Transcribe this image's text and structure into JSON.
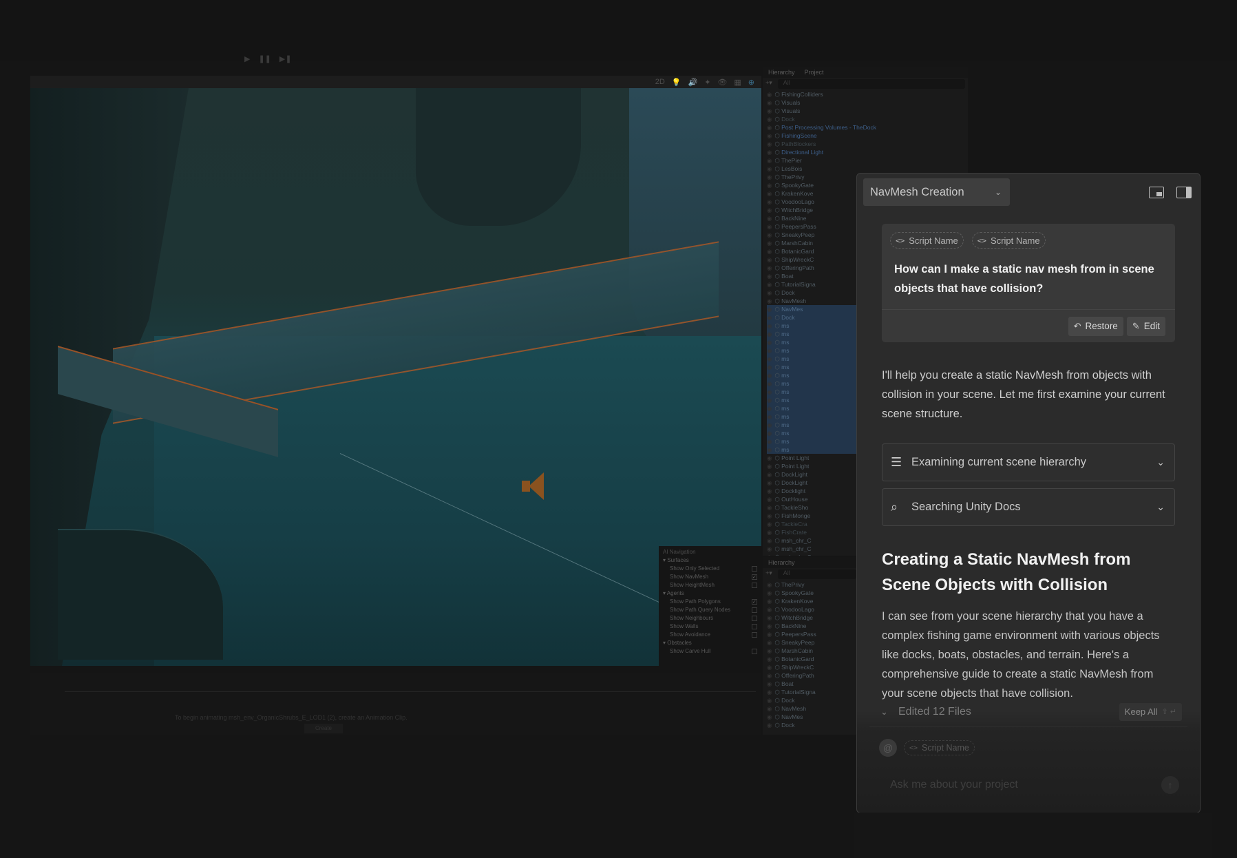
{
  "editor": {
    "toolbar_icons": [
      "2D",
      "💡",
      "🔊",
      "✦",
      "👁",
      "▦",
      "⊕"
    ],
    "ai_navigation": {
      "title": "AI Navigation",
      "sections": [
        {
          "label": "Surfaces",
          "items": [
            {
              "label": "Show Only Selected",
              "checked": false
            },
            {
              "label": "Show NavMesh",
              "checked": true
            },
            {
              "label": "Show HeightMesh",
              "checked": false
            }
          ]
        },
        {
          "label": "Agents",
          "items": [
            {
              "label": "Show Path Polygons",
              "checked": true
            },
            {
              "label": "Show Path Query Nodes",
              "checked": false
            },
            {
              "label": "Show Neighbours",
              "checked": false
            },
            {
              "label": "Show Walls",
              "checked": false
            },
            {
              "label": "Show Avoidance",
              "checked": false
            }
          ]
        },
        {
          "label": "Obstacles",
          "items": [
            {
              "label": "Show Carve Hull",
              "checked": false
            }
          ]
        }
      ]
    },
    "timeline": {
      "message": "To begin animating msh_env_OrganicShrubs_E_LOD1 (2), create an Animation Clip.",
      "create_label": "Create"
    },
    "hierarchy": {
      "tab_hierarchy": "Hierarchy",
      "tab_project": "Project",
      "search_placeholder": "All",
      "items": [
        {
          "label": "FishingColliders",
          "style": ""
        },
        {
          "label": "Visuals",
          "style": ""
        },
        {
          "label": "Visuals",
          "style": ""
        },
        {
          "label": "Dock",
          "style": "dim"
        },
        {
          "label": "Post Processing Volumes - TheDock",
          "style": "blue"
        },
        {
          "label": "FishingScene",
          "style": "blue"
        },
        {
          "label": "PathBlockers",
          "style": "dim"
        },
        {
          "label": "Directional Light",
          "style": "blue"
        },
        {
          "label": "ThePier",
          "style": ""
        },
        {
          "label": "LesBois",
          "style": ""
        },
        {
          "label": "ThePrivy",
          "style": ""
        },
        {
          "label": "SpookyGate",
          "style": ""
        },
        {
          "label": "KrakenKove",
          "style": ""
        },
        {
          "label": "VoodooLago",
          "style": ""
        },
        {
          "label": "WitchBridge",
          "style": ""
        },
        {
          "label": "BackNine",
          "style": ""
        },
        {
          "label": "PeepersPass",
          "style": ""
        },
        {
          "label": "SneakyPeep",
          "style": ""
        },
        {
          "label": "MarshCabin",
          "style": ""
        },
        {
          "label": "BotanicGard",
          "style": ""
        },
        {
          "label": "ShipWreckC",
          "style": ""
        },
        {
          "label": "OfferingPath",
          "style": ""
        },
        {
          "label": "Boat",
          "style": ""
        },
        {
          "label": "TutorialSigna",
          "style": ""
        },
        {
          "label": "Dock",
          "style": ""
        },
        {
          "label": "NavMesh",
          "style": ""
        },
        {
          "label": "NavMes",
          "style": "sel"
        },
        {
          "label": "Dock",
          "style": "sel"
        },
        {
          "label": "ms",
          "style": "sel"
        },
        {
          "label": "ms",
          "style": "sel"
        },
        {
          "label": "ms",
          "style": "sel"
        },
        {
          "label": "ms",
          "style": "sel"
        },
        {
          "label": "ms",
          "style": "sel"
        },
        {
          "label": "ms",
          "style": "sel"
        },
        {
          "label": "ms",
          "style": "sel"
        },
        {
          "label": "ms",
          "style": "sel"
        },
        {
          "label": "ms",
          "style": "sel"
        },
        {
          "label": "ms",
          "style": "sel"
        },
        {
          "label": "ms",
          "style": "sel"
        },
        {
          "label": "ms",
          "style": "sel"
        },
        {
          "label": "ms",
          "style": "sel"
        },
        {
          "label": "ms",
          "style": "sel"
        },
        {
          "label": "ms",
          "style": "sel"
        },
        {
          "label": "ms",
          "style": "sel"
        },
        {
          "label": "Point Light",
          "style": ""
        },
        {
          "label": "Point Light",
          "style": ""
        },
        {
          "label": "DockLight",
          "style": ""
        },
        {
          "label": "DockLight",
          "style": ""
        },
        {
          "label": "Docklight",
          "style": ""
        },
        {
          "label": "OutHouse",
          "style": ""
        },
        {
          "label": "TackleSho",
          "style": ""
        },
        {
          "label": "FishMonge",
          "style": ""
        },
        {
          "label": "TackleCra",
          "style": "dim"
        },
        {
          "label": "FishCrate",
          "style": "dim"
        },
        {
          "label": "msh_chr_C",
          "style": ""
        },
        {
          "label": "msh_chr_C",
          "style": ""
        },
        {
          "label": "msh_chr_C",
          "style": ""
        }
      ],
      "items2": [
        {
          "label": "ThePrivy",
          "style": ""
        },
        {
          "label": "SpookyGate",
          "style": ""
        },
        {
          "label": "KrakenKove",
          "style": ""
        },
        {
          "label": "VoodooLago",
          "style": ""
        },
        {
          "label": "WitchBridge",
          "style": ""
        },
        {
          "label": "BackNine",
          "style": ""
        },
        {
          "label": "PeepersPass",
          "style": ""
        },
        {
          "label": "SneakyPeep",
          "style": ""
        },
        {
          "label": "MarshCabin",
          "style": ""
        },
        {
          "label": "BotanicGard",
          "style": ""
        },
        {
          "label": "ShipWreckC",
          "style": ""
        },
        {
          "label": "OfferingPath",
          "style": ""
        },
        {
          "label": "Boat",
          "style": ""
        },
        {
          "label": "TutorialSigna",
          "style": ""
        },
        {
          "label": "Dock",
          "style": ""
        },
        {
          "label": "NavMesh",
          "style": ""
        },
        {
          "label": "NavMes",
          "style": ""
        },
        {
          "label": "Dock",
          "style": ""
        }
      ]
    }
  },
  "assistant": {
    "conversation_title": "NavMesh Creation",
    "context_chips": [
      "Script Name",
      "Script Name"
    ],
    "user_question": "How can I make a static nav mesh from in scene objects that have collision?",
    "restore_label": "Restore",
    "edit_label": "Edit",
    "intro": "I'll help you create a static NavMesh from objects with collision in your scene. Let me first examine your current scene structure.",
    "tools": [
      {
        "icon": "list-icon",
        "label": "Examining current scene hierarchy"
      },
      {
        "icon": "search-icon",
        "label": "Searching Unity Docs"
      }
    ],
    "heading": "Creating a Static NavMesh from Scene Objects with Collision",
    "body": "I can see from your scene hierarchy that you have a complex fishing game environment with various objects like docks, boats, obstacles, and terrain. Here's a comprehensive guide to create a static NavMesh from your scene objects that have collision.",
    "edited_files_label": "Edited 12 Files",
    "keep_all_label": "Keep All",
    "keep_all_shortcut": "⇧ ↵",
    "footer_chip": "Script Name",
    "input_placeholder": "Ask me about your project"
  }
}
